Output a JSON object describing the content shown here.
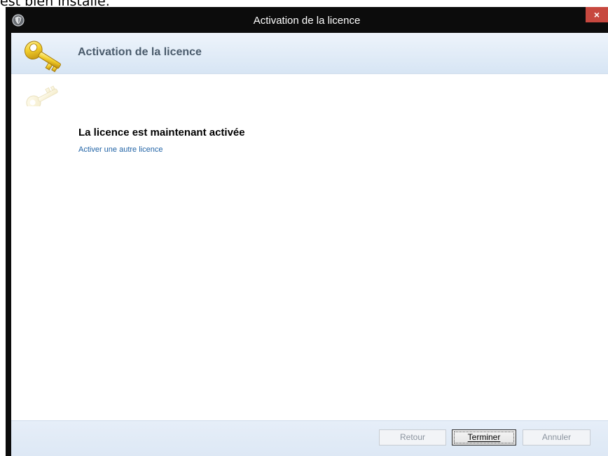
{
  "caption": {
    "text": "est bien installé."
  },
  "window": {
    "title": "Activation de la licence",
    "close_label": "×",
    "app_icon": "shield-icon"
  },
  "header": {
    "title": "Activation de la licence",
    "icon": "keys-icon"
  },
  "main": {
    "heading": "La licence est maintenant activée",
    "link": "Activer une autre licence"
  },
  "footer": {
    "back_label": "Retour",
    "finish_label": "Terminer",
    "cancel_label": "Annuler"
  },
  "colors": {
    "titlebar": "#0c0c0c",
    "close_button": "#c7483f",
    "link": "#2264a6",
    "header_text": "#4a5b6c"
  }
}
